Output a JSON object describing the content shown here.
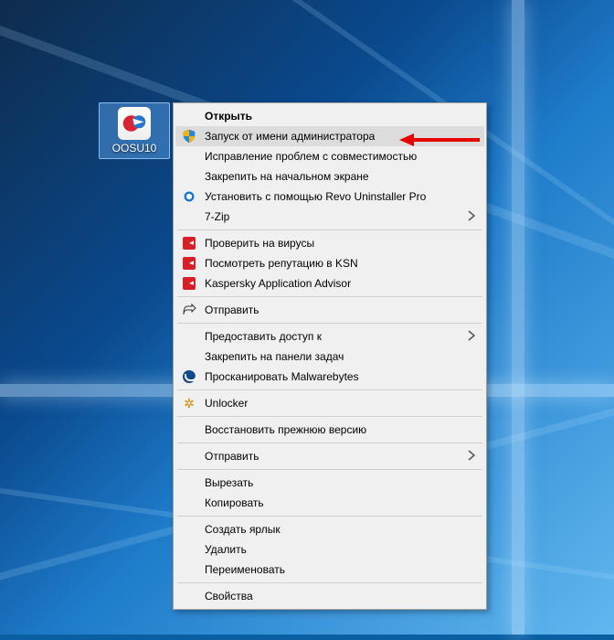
{
  "desktop": {
    "icon": {
      "label": "OOSU10",
      "selected": true
    }
  },
  "context_menu": {
    "open": "Открыть",
    "run_as_admin": "Запуск от имени администратора",
    "compat_troubleshoot": "Исправление проблем с совместимостью",
    "pin_start": "Закрепить на начальном экране",
    "revo_install": "Установить с помощью Revo Uninstaller Pro",
    "seven_zip": "7-Zip",
    "kasp_scan": "Проверить на вирусы",
    "kasp_ksn": "Посмотреть репутацию в KSN",
    "kasp_advisor": "Kaspersky Application Advisor",
    "share1": "Отправить",
    "grant_access": "Предоставить доступ к",
    "pin_taskbar": "Закрепить на панели задач",
    "malwarebytes": "Просканировать Malwarebytes",
    "unlocker": "Unlocker",
    "restore_prev": "Восстановить прежнюю версию",
    "send_to": "Отправить",
    "cut": "Вырезать",
    "copy": "Копировать",
    "create_shortcut": "Создать ярлык",
    "delete": "Удалить",
    "rename": "Переименовать",
    "properties": "Свойства"
  },
  "annotation": {
    "color": "#e60000"
  }
}
